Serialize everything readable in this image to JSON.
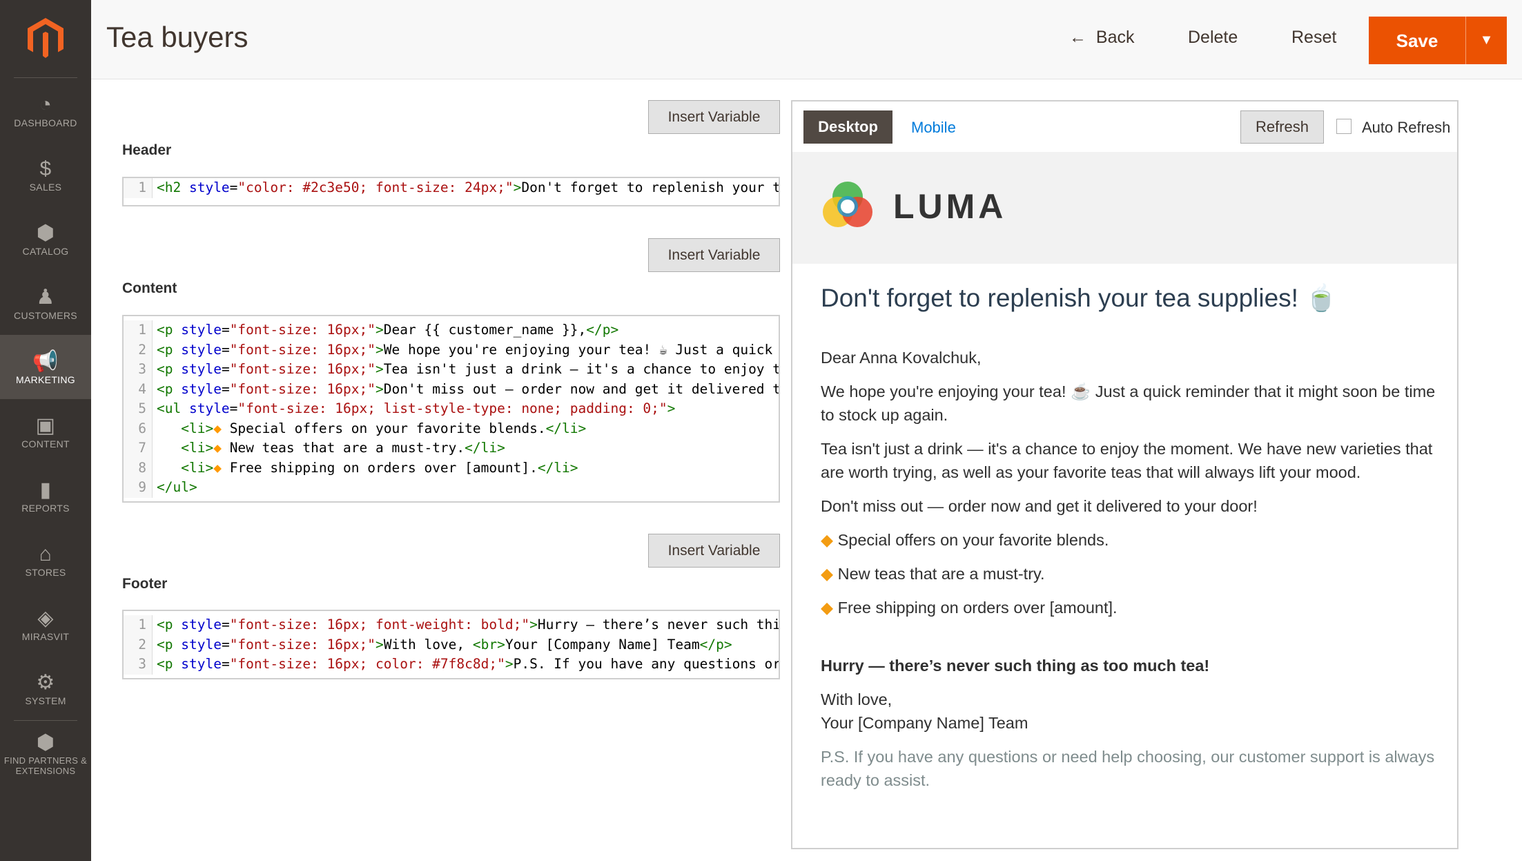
{
  "sidebar": {
    "items": [
      {
        "label": "DASHBOARD",
        "icon": "dashboard-icon",
        "glyph": "◔"
      },
      {
        "label": "SALES",
        "icon": "dollar-icon",
        "glyph": "$"
      },
      {
        "label": "CATALOG",
        "icon": "box-icon",
        "glyph": "⬢"
      },
      {
        "label": "CUSTOMERS",
        "icon": "person-icon",
        "glyph": "♟"
      },
      {
        "label": "MARKETING",
        "icon": "megaphone-icon",
        "glyph": "📢",
        "active": true
      },
      {
        "label": "CONTENT",
        "icon": "layout-icon",
        "glyph": "▣"
      },
      {
        "label": "REPORTS",
        "icon": "bar-chart-icon",
        "glyph": "▮"
      },
      {
        "label": "STORES",
        "icon": "store-icon",
        "glyph": "⌂"
      },
      {
        "label": "MIRASVIT",
        "icon": "mirasvit-icon",
        "glyph": "◈"
      },
      {
        "label": "SYSTEM",
        "icon": "gear-icon",
        "glyph": "⚙"
      },
      {
        "label": "FIND PARTNERS & EXTENSIONS",
        "icon": "extensions-icon",
        "glyph": "⬢"
      }
    ]
  },
  "header": {
    "title": "Tea buyers",
    "back": "Back",
    "delete": "Delete",
    "reset": "Reset",
    "save": "Save"
  },
  "editor": {
    "insert_variable": "Insert Variable",
    "header_label": "Header",
    "content_label": "Content",
    "footer_label": "Footer",
    "header_code": [
      [
        [
          "tag",
          "<h2 "
        ],
        [
          "att",
          "style"
        ],
        [
          "txt",
          "="
        ],
        [
          "str",
          "\"color: #2c3e50; font-size: 24px;\""
        ],
        [
          "tag",
          ">"
        ],
        [
          "txt",
          "Don't forget to replenish your tea supplies!"
        ]
      ]
    ],
    "content_code": [
      [
        [
          "tag",
          "<p "
        ],
        [
          "att",
          "style"
        ],
        [
          "txt",
          "="
        ],
        [
          "str",
          "\"font-size: 16px;\""
        ],
        [
          "tag",
          ">"
        ],
        [
          "txt",
          "Dear {{ customer_name }},"
        ],
        [
          "tag",
          "</p>"
        ]
      ],
      [
        [
          "tag",
          "<p "
        ],
        [
          "att",
          "style"
        ],
        [
          "txt",
          "="
        ],
        [
          "str",
          "\"font-size: 16px;\""
        ],
        [
          "tag",
          ">"
        ],
        [
          "txt",
          "We hope you're enjoying your tea! ☕ Just a quick reminder"
        ]
      ],
      [
        [
          "tag",
          "<p "
        ],
        [
          "att",
          "style"
        ],
        [
          "txt",
          "="
        ],
        [
          "str",
          "\"font-size: 16px;\""
        ],
        [
          "tag",
          ">"
        ],
        [
          "txt",
          "Tea isn't just a drink — it's a chance to enjoy the moment."
        ]
      ],
      [
        [
          "tag",
          "<p "
        ],
        [
          "att",
          "style"
        ],
        [
          "txt",
          "="
        ],
        [
          "str",
          "\"font-size: 16px;\""
        ],
        [
          "tag",
          ">"
        ],
        [
          "txt",
          "Don't miss out — order now and get it delivered to your door!"
        ]
      ],
      [
        [
          "tag",
          "<ul "
        ],
        [
          "att",
          "style"
        ],
        [
          "txt",
          "="
        ],
        [
          "str",
          "\"font-size: 16px; list-style-type: none; padding: 0;\""
        ],
        [
          "tag",
          ">"
        ]
      ],
      [
        [
          "txt",
          "   "
        ],
        [
          "tag",
          "<li>"
        ],
        [
          "dia",
          "◆"
        ],
        [
          "txt",
          " Special offers on your favorite blends."
        ],
        [
          "tag",
          "</li>"
        ]
      ],
      [
        [
          "txt",
          "   "
        ],
        [
          "tag",
          "<li>"
        ],
        [
          "dia",
          "◆"
        ],
        [
          "txt",
          " New teas that are a must-try."
        ],
        [
          "tag",
          "</li>"
        ]
      ],
      [
        [
          "txt",
          "   "
        ],
        [
          "tag",
          "<li>"
        ],
        [
          "dia",
          "◆"
        ],
        [
          "txt",
          " Free shipping on orders over [amount]."
        ],
        [
          "tag",
          "</li>"
        ]
      ],
      [
        [
          "tag",
          "</ul>"
        ]
      ]
    ],
    "footer_code": [
      [
        [
          "tag",
          "<p "
        ],
        [
          "att",
          "style"
        ],
        [
          "txt",
          "="
        ],
        [
          "str",
          "\"font-size: 16px; font-weight: bold;\""
        ],
        [
          "tag",
          ">"
        ],
        [
          "txt",
          "Hurry — there’s never such thing as too much tea!"
        ]
      ],
      [
        [
          "tag",
          "<p "
        ],
        [
          "att",
          "style"
        ],
        [
          "txt",
          "="
        ],
        [
          "str",
          "\"font-size: 16px;\""
        ],
        [
          "tag",
          ">"
        ],
        [
          "txt",
          "With love, "
        ],
        [
          "tag",
          "<br>"
        ],
        [
          "txt",
          "Your [Company Name] Team"
        ],
        [
          "tag",
          "</p>"
        ]
      ],
      [
        [
          "tag",
          "<p "
        ],
        [
          "att",
          "style"
        ],
        [
          "txt",
          "="
        ],
        [
          "str",
          "\"font-size: 16px; color: #7f8c8d;\""
        ],
        [
          "tag",
          ">"
        ],
        [
          "txt",
          "P.S. If you have any questions or need help choosing"
        ]
      ]
    ]
  },
  "preview": {
    "desktop": "Desktop",
    "mobile": "Mobile",
    "refresh": "Refresh",
    "auto_refresh": "Auto Refresh",
    "brand": "LUMA",
    "heading": "Don't forget to replenish your tea supplies! 🍵",
    "greeting": "Dear Anna Kovalchuk,",
    "p1": "We hope you're enjoying your tea! ☕ Just a quick reminder that it might soon be time to stock up again.",
    "p2": "Tea isn't just a drink — it's a chance to enjoy the moment. We have new varieties that are worth trying, as well as your favorite teas that will always lift your mood.",
    "p3": "Don't miss out — order now and get it delivered to your door!",
    "bullets": [
      "Special offers on your favorite blends.",
      "New teas that are a must-try.",
      "Free shipping on orders over [amount]."
    ],
    "bullet_glyph": "◆",
    "hurry": "Hurry — there’s never such thing as too much tea!",
    "love": "With love,",
    "team": "Your [Company Name] Team",
    "ps": "P.S. If you have any questions or need help choosing, our customer support is always ready to assist."
  },
  "colors": {
    "accent": "#eb5202",
    "sidebar": "#373330",
    "heading": "#2c3e50",
    "ps": "#7f8c8d"
  }
}
